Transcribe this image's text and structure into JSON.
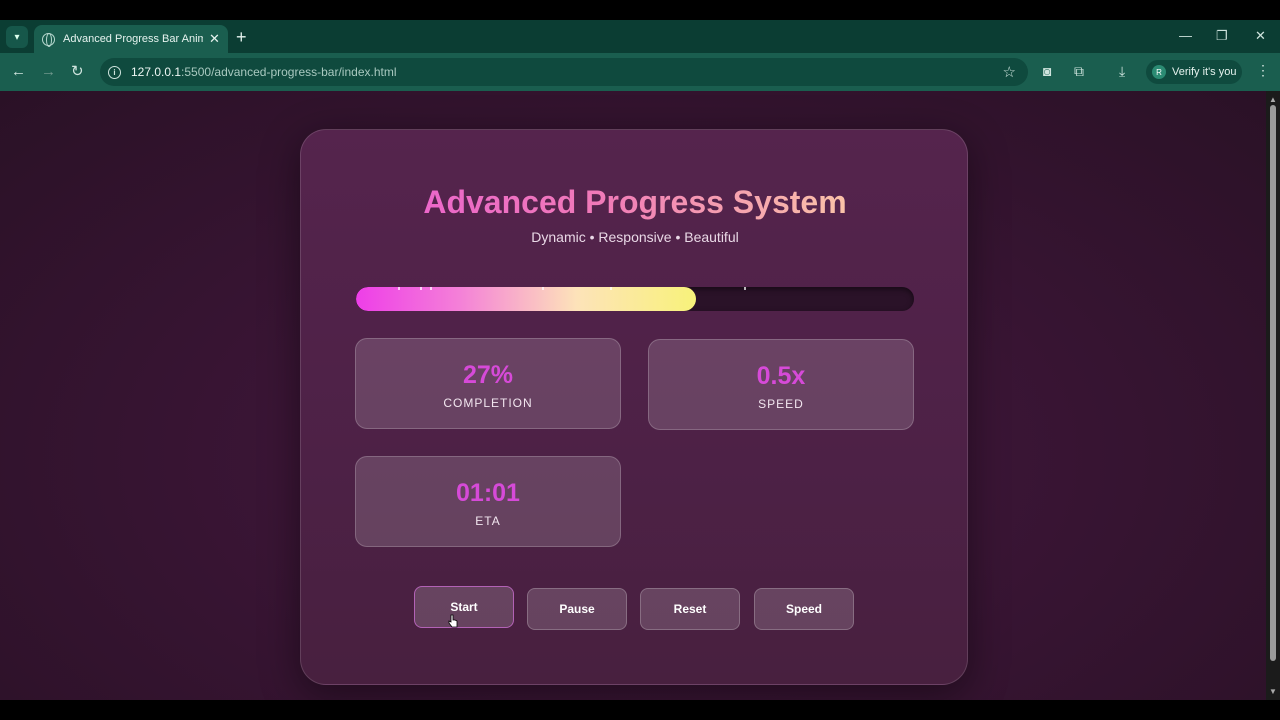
{
  "browser": {
    "tab": {
      "title": "Advanced Progress Bar Animati",
      "close": "✕"
    },
    "new_tab": "+",
    "window_controls": {
      "minimize": "—",
      "restore": "❐",
      "close": "✕"
    },
    "url": {
      "host": "127.0.0.1",
      "path": ":5500/advanced-progress-bar/index.html"
    },
    "profile": {
      "initial": "R",
      "label": "Verify it's you"
    }
  },
  "app": {
    "title": "Advanced Progress System",
    "subtitle": "Dynamic • Responsive • Beautiful",
    "progress_fraction": 0.61,
    "stats": {
      "completion": {
        "value": "27%",
        "label": "COMPLETION"
      },
      "speed": {
        "value": "0.5x",
        "label": "SPEED"
      },
      "eta": {
        "value": "01:01",
        "label": "ETA"
      }
    },
    "buttons": {
      "start": "Start",
      "pause": "Pause",
      "reset": "Reset",
      "speed": "Speed"
    }
  },
  "icons": [
    "tab-search-icon",
    "globe-icon",
    "back-icon",
    "forward-icon",
    "reload-icon",
    "info-icon",
    "star-icon",
    "camera-icon",
    "extensions-icon",
    "download-icon",
    "menu-icon"
  ],
  "colors": {
    "accent": "#d64ad8",
    "toolbar": "#1a5e4f",
    "tabstrip": "#0b3d33"
  }
}
